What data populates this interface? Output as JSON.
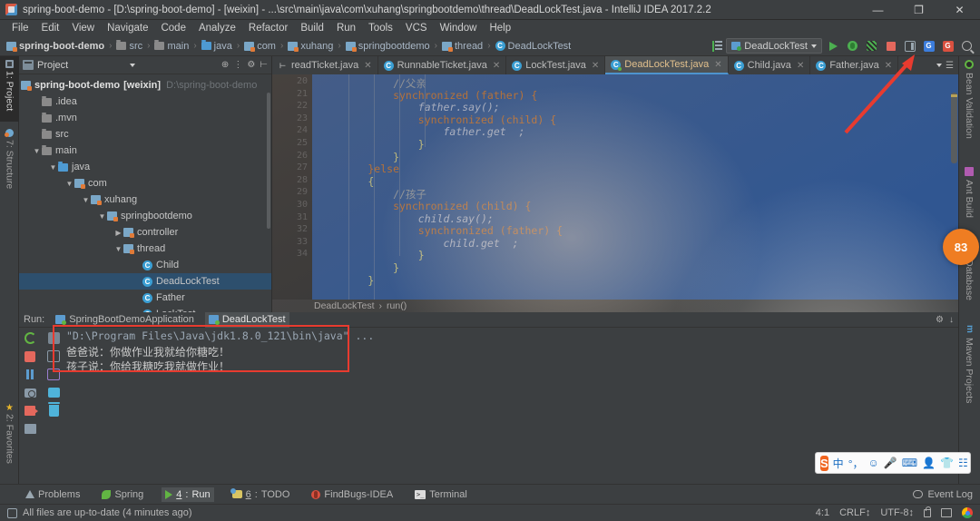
{
  "window": {
    "title": "spring-boot-demo - [D:\\spring-boot-demo] - [weixin] - ...\\src\\main\\java\\com\\xuhang\\springbootdemo\\thread\\DeadLockTest.java - IntelliJ IDEA 2017.2.2",
    "minimize": "—",
    "maximize": "❐",
    "close": "✕"
  },
  "menu": [
    "File",
    "Edit",
    "View",
    "Navigate",
    "Code",
    "Analyze",
    "Refactor",
    "Build",
    "Run",
    "Tools",
    "VCS",
    "Window",
    "Help"
  ],
  "navbar": {
    "crumbs": [
      {
        "label": "spring-boot-demo",
        "icon": "module-icon",
        "bold": true
      },
      {
        "label": "src",
        "icon": "folder-icon",
        "bold": false
      },
      {
        "label": "main",
        "icon": "folder-icon",
        "bold": false
      },
      {
        "label": "java",
        "icon": "source-folder-icon",
        "bold": false
      },
      {
        "label": "com",
        "icon": "package-icon",
        "bold": false
      },
      {
        "label": "xuhang",
        "icon": "package-icon",
        "bold": false
      },
      {
        "label": "springbootdemo",
        "icon": "package-icon",
        "bold": false
      },
      {
        "label": "thread",
        "icon": "package-icon",
        "bold": false
      },
      {
        "label": "DeadLockTest",
        "icon": "class-icon",
        "bold": false
      }
    ],
    "separator": "›",
    "run_config": "DeadLockTest",
    "buttons": [
      "run-button",
      "debug-button",
      "run-with-coverage-button",
      "stop-button",
      "layout-button",
      "google-doc-button",
      "google-doc-red-button",
      "search-everywhere-button"
    ]
  },
  "left_strip": [
    {
      "label": "1: Project",
      "icon": "project-icon",
      "active": true
    },
    {
      "label": "7: Structure",
      "icon": "structure-icon",
      "active": false
    },
    {
      "label": "2: Favorites",
      "icon": "star-icon",
      "active": false
    }
  ],
  "right_strip": [
    {
      "label": "Bean Validation",
      "icon": "bean-icon"
    },
    {
      "label": "Ant Build",
      "icon": "ant-icon"
    },
    {
      "label": "Database",
      "icon": "database-icon"
    },
    {
      "label": "Maven Projects",
      "icon": "maven-icon"
    }
  ],
  "inspection_badge": "83",
  "project_panel": {
    "title": "Project",
    "tools": [
      "collapse-all-icon",
      "expand-icon",
      "settings-icon",
      "hide-icon"
    ],
    "tree": [
      {
        "depth": 0,
        "arrow": "",
        "label": "spring-boot-demo",
        "bold": true,
        "sub": "[weixin]",
        "path": "D:\\spring-boot-demo",
        "icon": "module-icon",
        "selected": false
      },
      {
        "depth": 1,
        "arrow": "",
        "label": ".idea",
        "icon": "folder-icon",
        "selected": false
      },
      {
        "depth": 1,
        "arrow": "",
        "label": ".mvn",
        "icon": "folder-icon",
        "selected": false
      },
      {
        "depth": 1,
        "arrow": "",
        "label": "src",
        "icon": "folder-icon",
        "selected": false
      },
      {
        "depth": 1,
        "arrow": "▼",
        "label": "main",
        "icon": "folder-icon",
        "selected": false
      },
      {
        "depth": 2,
        "arrow": "▼",
        "label": "java",
        "icon": "source-folder-icon",
        "selected": false
      },
      {
        "depth": 3,
        "arrow": "▼",
        "label": "com",
        "icon": "package-icon",
        "selected": false
      },
      {
        "depth": 4,
        "arrow": "▼",
        "label": "xuhang",
        "icon": "package-icon",
        "selected": false
      },
      {
        "depth": 5,
        "arrow": "▼",
        "label": "springbootdemo",
        "icon": "package-icon",
        "selected": false
      },
      {
        "depth": 6,
        "arrow": "▶",
        "label": "controller",
        "icon": "package-icon",
        "selected": false
      },
      {
        "depth": 6,
        "arrow": "▼",
        "label": "thread",
        "icon": "package-icon",
        "selected": false
      },
      {
        "depth": 7,
        "arrow": "",
        "label": "Child",
        "icon": "class-icon",
        "selected": false
      },
      {
        "depth": 7,
        "arrow": "",
        "label": "DeadLockTest",
        "icon": "class-modified-icon",
        "selected": true
      },
      {
        "depth": 7,
        "arrow": "",
        "label": "Father",
        "icon": "class-icon",
        "selected": false
      },
      {
        "depth": 7,
        "arrow": "",
        "label": "LockTest",
        "icon": "class-modified-icon",
        "selected": false
      }
    ]
  },
  "editor": {
    "tabs": [
      {
        "label": "readTicket.java",
        "icon": "file-plain-icon",
        "active": false
      },
      {
        "label": "RunnableTicket.java",
        "icon": "class-icon",
        "active": false
      },
      {
        "label": "LockTest.java",
        "icon": "class-icon",
        "active": false
      },
      {
        "label": "DeadLockTest.java",
        "icon": "class-modified-icon",
        "active": true
      },
      {
        "label": "Child.java",
        "icon": "class-icon",
        "active": false
      },
      {
        "label": "Father.java",
        "icon": "class-icon",
        "active": false
      }
    ],
    "close_glyph": "✕",
    "first_line_number": 20,
    "lines": [
      {
        "n": 20,
        "text": "            //父亲",
        "kind": "comment"
      },
      {
        "n": 21,
        "text": "            synchronized (father) {",
        "kind": "code"
      },
      {
        "n": 22,
        "text": "                father.say();",
        "kind": "code"
      },
      {
        "n": 23,
        "text": "                synchronized (child) {",
        "kind": "code"
      },
      {
        "n": 24,
        "text": "                    father.get  ;",
        "kind": "code"
      },
      {
        "n": 25,
        "text": "                }",
        "kind": "code"
      },
      {
        "n": 26,
        "text": "            }",
        "kind": "code"
      },
      {
        "n": 27,
        "text": "        }else",
        "kind": "code"
      },
      {
        "n": 28,
        "text": "        {",
        "kind": "code"
      },
      {
        "n": 29,
        "text": "            //孩子",
        "kind": "comment"
      },
      {
        "n": 30,
        "text": "            synchronized (child) {",
        "kind": "code"
      },
      {
        "n": 31,
        "text": "                child.say();",
        "kind": "code"
      },
      {
        "n": 32,
        "text": "                synchronized (father) {",
        "kind": "code"
      },
      {
        "n": 33,
        "text": "                    child.get  ;",
        "kind": "code"
      },
      {
        "n": 34,
        "text": "                }",
        "kind": "code"
      },
      {
        "n": 35,
        "text": "            }",
        "kind": "code"
      },
      {
        "n": 36,
        "text": "        }",
        "kind": "code"
      }
    ],
    "gutter_numbers": [
      "20",
      "21",
      "22",
      "23",
      "24",
      "25",
      "26",
      "27",
      "28",
      "29",
      "30",
      "31",
      "32",
      "33",
      "34"
    ],
    "breadcrumb": [
      "DeadLockTest",
      "run()"
    ],
    "breadcrumb_separator": "›"
  },
  "run_panel": {
    "label": "Run:",
    "tabs": [
      {
        "label": "SpringBootDemoApplication",
        "active": false
      },
      {
        "label": "DeadLockTest",
        "active": true
      }
    ],
    "toolbar_primary": [
      "rerun-icon",
      "stop-icon",
      "pause-icon",
      "dump-threads-icon",
      "exit-icon",
      "print-settings-icon"
    ],
    "toolbar_secondary": [
      "up-icon",
      "soft-wrap-icon",
      "scroll-to-end-icon",
      "print-icon",
      "clear-all-icon"
    ],
    "header_tools": [
      "settings-icon",
      "hide-icon"
    ],
    "console": [
      "\"D:\\Program Files\\Java\\jdk1.8.0_121\\bin\\java\" ...",
      "爸爸说：你做作业我就给你糖吃！",
      "孩子说：你给我糖吃我就做作业！"
    ]
  },
  "ime": {
    "logo": "S",
    "items": [
      "中",
      "°，",
      "☺",
      "mic-icon",
      "keyboard-icon",
      "user-icon",
      "skin-icon",
      "apps-icon"
    ]
  },
  "toolwindow_bar": {
    "items": [
      {
        "label": "Problems",
        "icon": "warning-icon",
        "active": false,
        "num": ""
      },
      {
        "label": "Spring",
        "icon": "spring-leaf-icon",
        "active": false,
        "num": ""
      },
      {
        "label": "Run",
        "icon": "run-icon",
        "active": true,
        "num": "4"
      },
      {
        "label": "TODO",
        "icon": "todo-icon",
        "active": false,
        "num": "6"
      },
      {
        "label": "FindBugs-IDEA",
        "icon": "findbugs-icon",
        "active": false,
        "num": ""
      },
      {
        "label": "Terminal",
        "icon": "terminal-icon",
        "active": false,
        "num": ""
      }
    ],
    "event_log": "Event Log"
  },
  "statusbar": {
    "message": "All files are up-to-date (4 minutes ago)",
    "caret": "4:1",
    "line_sep": "CRLF↕",
    "encoding": "UTF-8↕",
    "lock": "lock-icon",
    "memory": "memory-icon",
    "browser": "chrome-icon"
  },
  "colors": {
    "accent_blue": "#4e94ce",
    "selection_blue": "#2f5a9c",
    "panel_bg": "#3c3f41",
    "editor_bg": "#2b2b2b",
    "highlight_red": "#e83b2f",
    "badge_orange": "#ef7d22"
  }
}
